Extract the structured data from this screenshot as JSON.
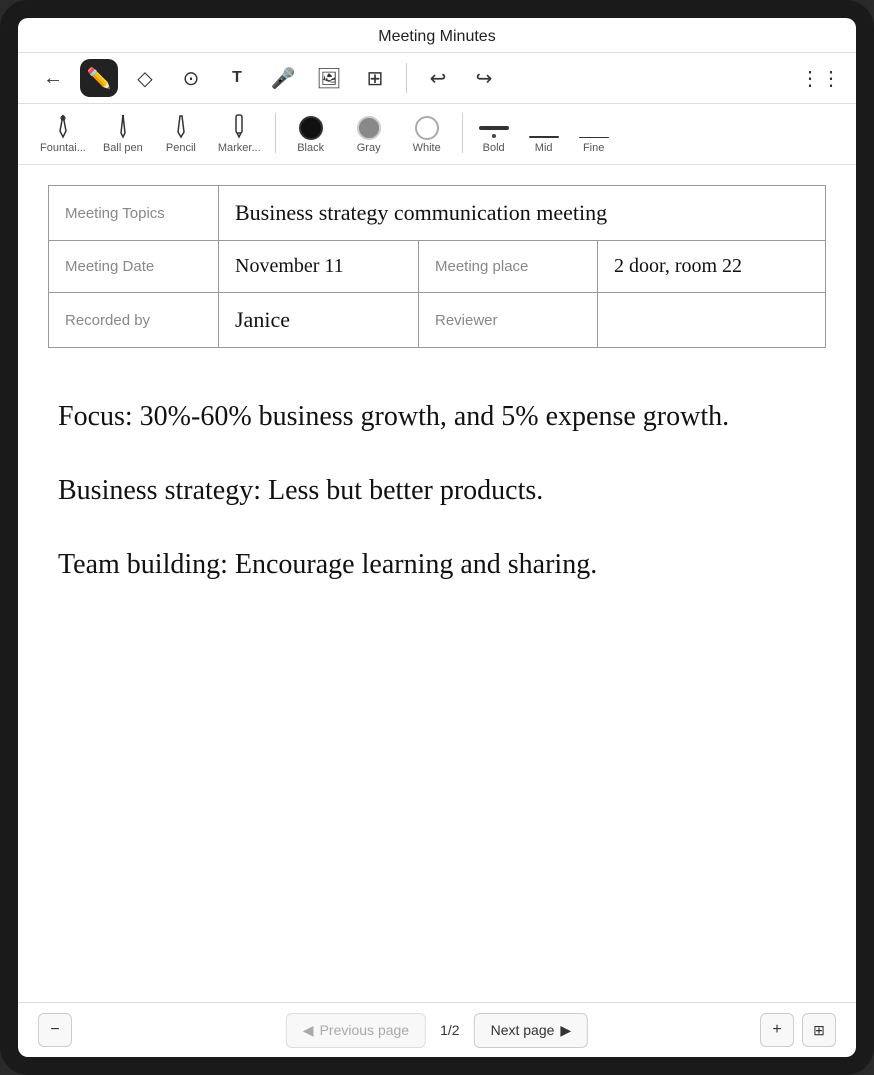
{
  "app": {
    "title": "Meeting Minutes"
  },
  "toolbar": {
    "back_icon": "←",
    "pen_icon": "✒",
    "eraser_icon": "◻",
    "lasso_icon": "⊙",
    "text_icon": "T",
    "mic_icon": "🎤",
    "image_icon": "🖼",
    "layout_icon": "⊞",
    "undo_icon": "↩",
    "redo_icon": "↪",
    "more_icon": "⋮⋮"
  },
  "pen_options": {
    "fountain_label": "Fountai...",
    "ballpen_label": "Ball pen",
    "pencil_label": "Pencil",
    "marker_label": "Marker...",
    "black_label": "Black",
    "gray_label": "Gray",
    "white_label": "White",
    "bold_label": "Bold",
    "mid_label": "Mid",
    "fine_label": "Fine"
  },
  "table": {
    "row1_label": "Meeting Topics",
    "row1_value": "Business strategy communication meeting",
    "row2_label": "Meeting Date",
    "row2_value": "November 11",
    "row3_label": "Meeting place",
    "row3_value": "2 door, room 22",
    "row4_label": "Recorded by",
    "row4_value": "Janice",
    "row4_label2": "Reviewer",
    "row4_value2": ""
  },
  "notes": {
    "line1": "Focus: 30%-60% business growth, and 5% expense growth.",
    "line2": "Business strategy: Less but better products.",
    "line3": "Team building: Encourage learning and sharing."
  },
  "pagination": {
    "previous_label": "Previous page",
    "next_label": "Next page",
    "current_page": "1",
    "total_pages": "2",
    "separator": "/"
  }
}
